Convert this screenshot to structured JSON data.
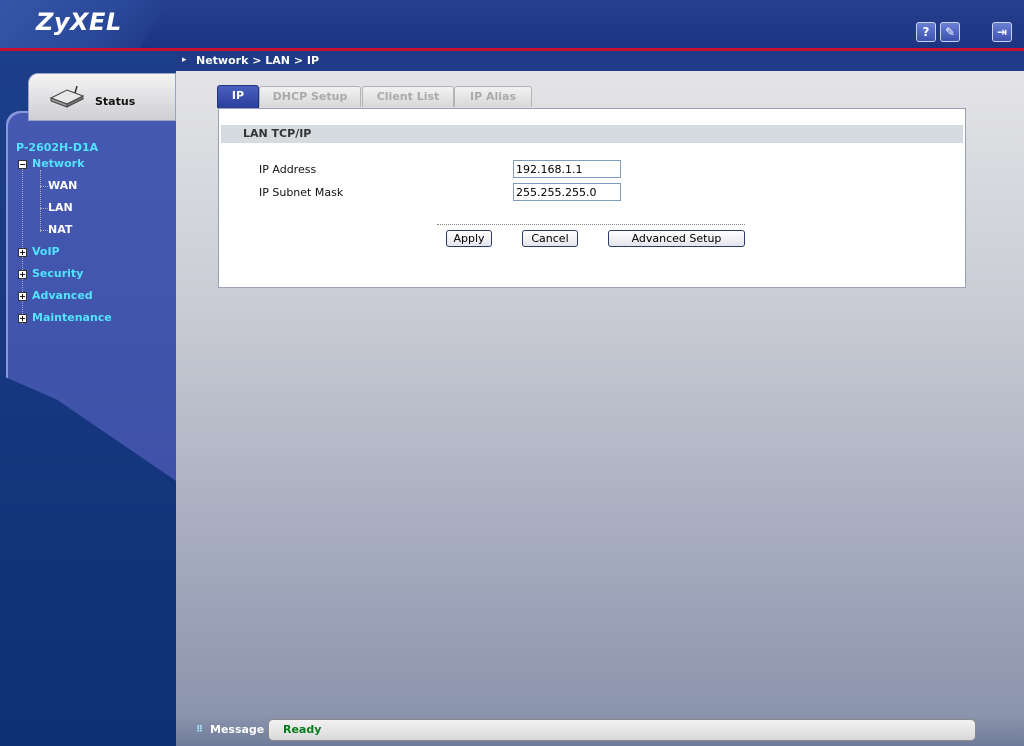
{
  "header": {
    "logo": "ZyXEL",
    "help_icon": "?",
    "wizard_icon": "wand-icon",
    "logout_icon": "logout-icon"
  },
  "sidebar": {
    "status_label": "Status",
    "model": "P-2602H-D1A",
    "tree": [
      {
        "label": "Network",
        "expanded": true,
        "children": [
          "WAN",
          "LAN",
          "NAT"
        ]
      },
      {
        "label": "VoIP",
        "expanded": false
      },
      {
        "label": "Security",
        "expanded": false
      },
      {
        "label": "Advanced",
        "expanded": false
      },
      {
        "label": "Maintenance",
        "expanded": false
      }
    ]
  },
  "breadcrumb": "Network > LAN > IP",
  "tabs": [
    "IP",
    "DHCP Setup",
    "Client List",
    "IP Alias"
  ],
  "form": {
    "section_title": "LAN TCP/IP",
    "ip_label": "IP Address",
    "ip_value": "192.168.1.1",
    "mask_label": "IP Subnet Mask",
    "mask_value": "255.255.255.0"
  },
  "buttons": {
    "apply": "Apply",
    "cancel": "Cancel",
    "advanced": "Advanced Setup"
  },
  "message": {
    "label": "Message",
    "text": "Ready"
  },
  "colors": {
    "brand_blue": "#1f3a86",
    "accent_red": "#c8102e",
    "tree_cyan": "#52e4ff",
    "status_green": "#0a7a1e"
  }
}
